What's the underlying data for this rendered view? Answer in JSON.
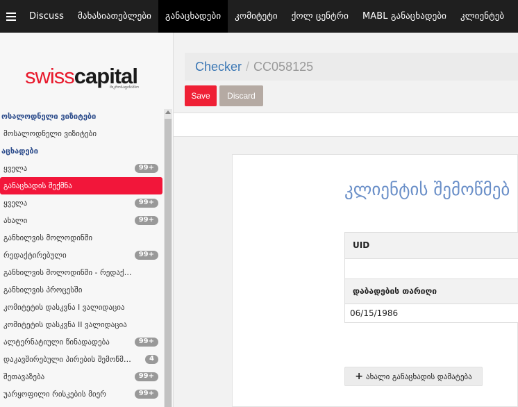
{
  "topnav": {
    "items": [
      {
        "label": "Discuss"
      },
      {
        "label": "მახასიათებლები"
      },
      {
        "label": "განაცხადები",
        "active": true
      },
      {
        "label": "კომიტეტი"
      },
      {
        "label": "ქოლ ცენტრი"
      },
      {
        "label": "MABL განაცხადები"
      },
      {
        "label": "კლიენტებ"
      }
    ]
  },
  "logo": {
    "swiss": "swiss",
    "capital": "capital",
    "sub": "მიკროსაფინანსო"
  },
  "sidebar": {
    "group1": "ოსალოდნელი ვიზიტები",
    "g1_item": "მოსალოდნელი ვიზიტები",
    "group2": "აცხადები",
    "items": [
      {
        "label": "ყველა",
        "badge": "99+"
      },
      {
        "label": "განაცხადის შექმნა",
        "active": true
      },
      {
        "label": "ყველა",
        "badge": "99+"
      },
      {
        "label": "ახალი",
        "badge": "99+"
      },
      {
        "label": "განხილვის მოლოდინში"
      },
      {
        "label": "რედაქტირებული",
        "badge": "99+"
      },
      {
        "label": "განხილვის მოლოდინში - რედაქტ..."
      },
      {
        "label": "განხილვის პროცესში"
      },
      {
        "label": "კომიტეტის დასკვნა I ვალიდაცია"
      },
      {
        "label": "კომიტეტის დასკვნა II ვალიდაცია"
      },
      {
        "label": "ალტერნატიული წინადადება",
        "badge": "99+"
      },
      {
        "label": "დაკავშირებული პირების შემოწმება",
        "badge": "4"
      },
      {
        "label": "შეთავაზება",
        "badge": "99+"
      },
      {
        "label": "უარყოფილი რისკების მიერ",
        "badge": "99+"
      }
    ]
  },
  "breadcrumb": {
    "parent": "Checker",
    "separator": "/",
    "current": "CC058125"
  },
  "buttons": {
    "save": "Save",
    "discard": "Discard"
  },
  "form": {
    "title": "კლიენტის შემოწმებ",
    "fields": [
      {
        "label": "UID",
        "value": ""
      },
      {
        "label": "დაბადების თარიღი",
        "value": "06/15/1986"
      }
    ],
    "add_button": "ახალი განაცხადის დამატება"
  },
  "colors": {
    "accent_red": "#ef2035",
    "link_blue": "#3c78b5",
    "title_blue": "#6a8fc8",
    "nav_bg": "#1f1f1f"
  }
}
